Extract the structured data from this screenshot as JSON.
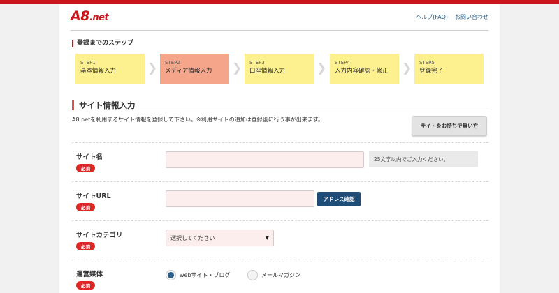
{
  "header": {
    "logo_text": "A8",
    "logo_suffix": ".net",
    "links": [
      "ヘルプ(FAQ)",
      "お問い合わせ"
    ]
  },
  "steps": {
    "title": "登録までのステップ",
    "items": [
      {
        "num": "STEP1",
        "label": "基本情報入力"
      },
      {
        "num": "STEP2",
        "label": "メディア情報入力",
        "active": true
      },
      {
        "num": "STEP3",
        "label": "口座情報入力"
      },
      {
        "num": "STEP4",
        "label": "入力内容確認・修正"
      },
      {
        "num": "STEP5",
        "label": "登録完了"
      }
    ]
  },
  "section": {
    "title": "サイト情報入力",
    "description": "A8.netを利用するサイト情報を登録して下さい。※利用サイトの追加は登録後に行う事が出来ます。",
    "no_site_button": "サイトをお持ちで無い方"
  },
  "form": {
    "required_badge": "必須",
    "site_name": {
      "label": "サイト名",
      "value": "",
      "hint": "25文字以内でご入力ください。"
    },
    "site_url": {
      "label": "サイトURL",
      "value": "",
      "check_button": "アドレス確認"
    },
    "site_category": {
      "label": "サイトカテゴリ",
      "selected": "選択してください"
    },
    "media": {
      "label": "運営媒体",
      "options": [
        {
          "label": "webサイト・ブログ",
          "checked": true
        },
        {
          "label": "メールマガジン",
          "checked": false
        }
      ]
    }
  },
  "colors": {
    "brand": "#c8161d",
    "step": "#fdf08f",
    "step_active": "#f5a68a",
    "required": "#e02525",
    "button_primary": "#1e4e78"
  }
}
